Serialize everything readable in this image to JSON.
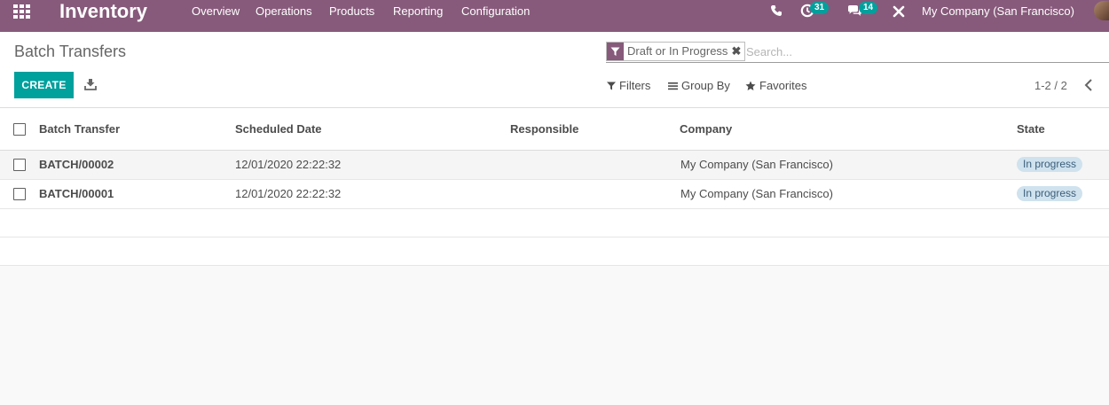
{
  "navbar": {
    "app_name": "Inventory",
    "menu": [
      "Overview",
      "Operations",
      "Products",
      "Reporting",
      "Configuration"
    ],
    "activity_count": "31",
    "message_count": "14",
    "company": "My Company (San Francisco)",
    "color": "#875a7b"
  },
  "control_panel": {
    "breadcrumb": "Batch Transfers",
    "facet": "Draft or In Progress",
    "facet_remove": "✖",
    "search_placeholder": "Search...",
    "create_label": "CREATE",
    "filters_label": "Filters",
    "group_by_label": "Group By",
    "favorites_label": "Favorites",
    "pager": "1-2 / 2",
    "accent": "#00a09d"
  },
  "table": {
    "columns": [
      "Batch Transfer",
      "Scheduled Date",
      "Responsible",
      "Company",
      "State"
    ],
    "rows": [
      {
        "name": "BATCH/00002",
        "date": "12/01/2020 22:22:32",
        "responsible": "",
        "company": "My Company (San Francisco)",
        "state": "In progress"
      },
      {
        "name": "BATCH/00001",
        "date": "12/01/2020 22:22:32",
        "responsible": "",
        "company": "My Company (San Francisco)",
        "state": "In progress"
      }
    ]
  }
}
